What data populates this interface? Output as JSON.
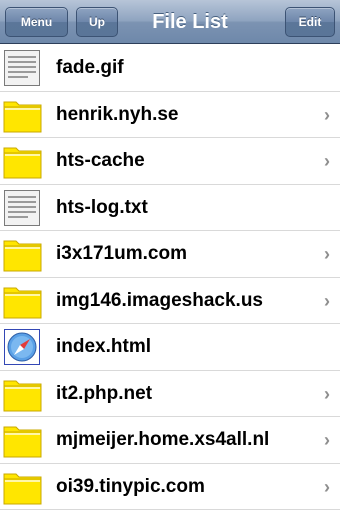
{
  "navbar": {
    "menu_label": "Menu",
    "up_label": "Up",
    "title": "File List",
    "edit_label": "Edit"
  },
  "colors": {
    "navbar": "#7c93b2",
    "folder": "#ffe600",
    "chevron": "#8e8e8e"
  },
  "files": [
    {
      "name": "fade.gif",
      "icon": "document-icon",
      "chevron": false
    },
    {
      "name": "henrik.nyh.se",
      "icon": "folder-icon",
      "chevron": true
    },
    {
      "name": "hts-cache",
      "icon": "folder-icon",
      "chevron": true
    },
    {
      "name": "hts-log.txt",
      "icon": "document-icon",
      "chevron": false
    },
    {
      "name": "i3x171um.com",
      "icon": "folder-icon",
      "chevron": true
    },
    {
      "name": "img146.imageshack.us",
      "icon": "folder-icon",
      "chevron": true
    },
    {
      "name": "index.html",
      "icon": "safari-icon",
      "chevron": false
    },
    {
      "name": "it2.php.net",
      "icon": "folder-icon",
      "chevron": true
    },
    {
      "name": "mjmeijer.home.xs4all.nl",
      "icon": "folder-icon",
      "chevron": true
    },
    {
      "name": "oi39.tinypic.com",
      "icon": "folder-icon",
      "chevron": true
    }
  ]
}
